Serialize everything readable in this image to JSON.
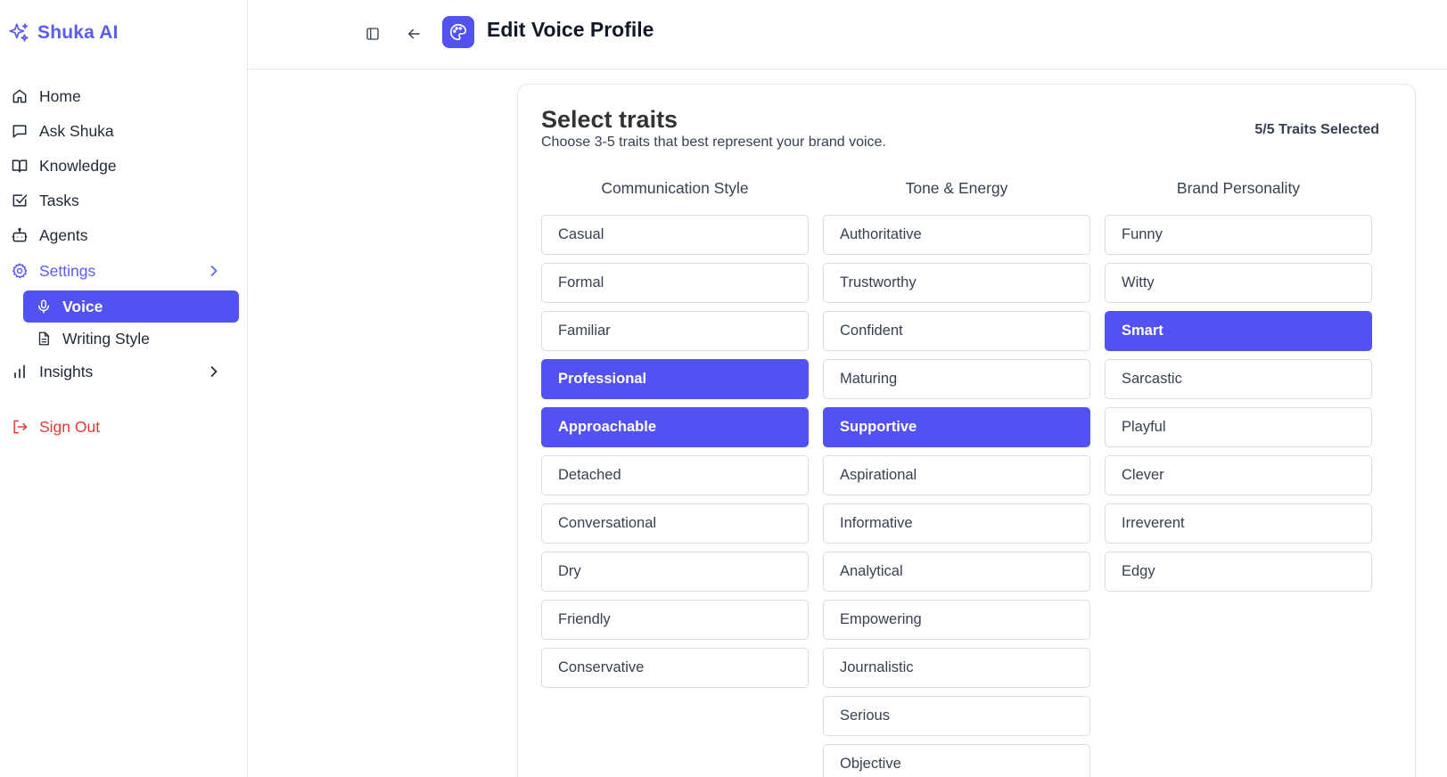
{
  "brand": {
    "name": "Shuka AI",
    "color": "#5b5bf0"
  },
  "sidebar": {
    "items": [
      {
        "label": "Home",
        "icon": "home-icon"
      },
      {
        "label": "Ask Shuka",
        "icon": "chat-icon"
      },
      {
        "label": "Knowledge",
        "icon": "book-icon"
      },
      {
        "label": "Tasks",
        "icon": "checkbox-icon"
      },
      {
        "label": "Agents",
        "icon": "robot-icon"
      },
      {
        "label": "Settings",
        "icon": "gear-icon",
        "expanded": true
      },
      {
        "label": "Insights",
        "icon": "bar-chart-icon"
      }
    ],
    "settings_sub": [
      {
        "label": "Voice",
        "icon": "microphone-icon",
        "active": true
      },
      {
        "label": "Writing Style",
        "icon": "document-icon",
        "active": false
      }
    ],
    "signout": {
      "label": "Sign Out",
      "icon": "logout-icon",
      "color": "#e53935"
    }
  },
  "header": {
    "title": "Edit Voice Profile",
    "icon": "palette-icon"
  },
  "selector": {
    "title": "Select traits",
    "subtitle": "Choose 3-5 traits that best represent your brand voice.",
    "count_text": "5/5 Traits Selected",
    "accent": "#5252f2",
    "columns": [
      {
        "title": "Communication Style",
        "traits": [
          {
            "label": "Casual",
            "selected": false
          },
          {
            "label": "Formal",
            "selected": false
          },
          {
            "label": "Familiar",
            "selected": false
          },
          {
            "label": "Professional",
            "selected": true
          },
          {
            "label": "Approachable",
            "selected": true
          },
          {
            "label": "Detached",
            "selected": false
          },
          {
            "label": "Conversational",
            "selected": false
          },
          {
            "label": "Dry",
            "selected": false
          },
          {
            "label": "Friendly",
            "selected": false
          },
          {
            "label": "Conservative",
            "selected": false
          }
        ]
      },
      {
        "title": "Tone & Energy",
        "traits": [
          {
            "label": "Authoritative",
            "selected": false
          },
          {
            "label": "Trustworthy",
            "selected": false
          },
          {
            "label": "Confident",
            "selected": false
          },
          {
            "label": "Maturing",
            "selected": false
          },
          {
            "label": "Supportive",
            "selected": true
          },
          {
            "label": "Aspirational",
            "selected": false
          },
          {
            "label": "Informative",
            "selected": false
          },
          {
            "label": "Analytical",
            "selected": false
          },
          {
            "label": "Empowering",
            "selected": false
          },
          {
            "label": "Journalistic",
            "selected": false
          },
          {
            "label": "Serious",
            "selected": false
          },
          {
            "label": "Objective",
            "selected": false
          }
        ]
      },
      {
        "title": "Brand Personality",
        "traits": [
          {
            "label": "Funny",
            "selected": false
          },
          {
            "label": "Witty",
            "selected": false
          },
          {
            "label": "Smart",
            "selected": true
          },
          {
            "label": "Sarcastic",
            "selected": false
          },
          {
            "label": "Playful",
            "selected": false
          },
          {
            "label": "Clever",
            "selected": false
          },
          {
            "label": "Irreverent",
            "selected": false
          },
          {
            "label": "Edgy",
            "selected": false
          }
        ]
      }
    ]
  }
}
